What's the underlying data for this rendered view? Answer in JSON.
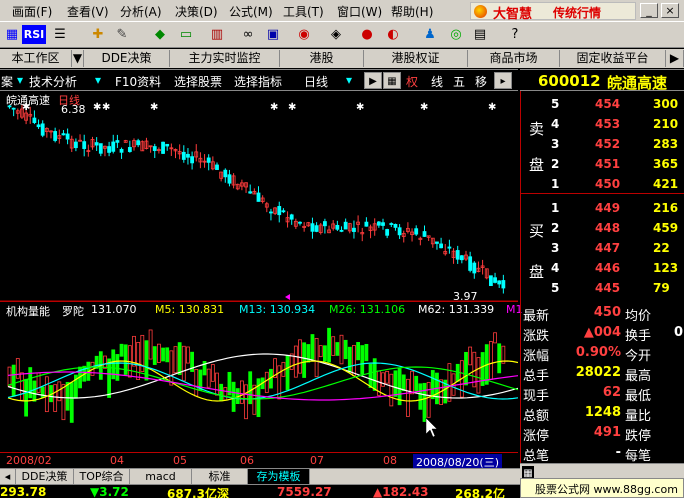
{
  "menu": [
    "画面(F)",
    "查看(V)",
    "分析(A)",
    "决策(D)",
    "公式(M)",
    "工具(T)",
    "窗口(W)",
    "帮助(H)"
  ],
  "brand": {
    "title": "大智慧",
    "subtitle": "传统行情"
  },
  "toolbar": {
    "rsi_label": "RSI"
  },
  "tabs": [
    "本工作区",
    "DDE决策",
    "主力实时监控",
    "港股",
    "港股权证",
    "商品市场",
    "固定收益平台"
  ],
  "subbar": {
    "first": "案",
    "tech": "技术分析",
    "f10": "F10资料",
    "select": "选择股票",
    "indicator": "选择指标",
    "period": "日线",
    "quan": "权",
    "xian": "线",
    "wu": "五",
    "yi": "移"
  },
  "stock": {
    "code": "600012",
    "name": "皖通高速"
  },
  "chart": {
    "title": "皖通高速",
    "period_tag": "日线",
    "high_label": "6.38",
    "low_label": "3.97"
  },
  "vol_line": {
    "name": "机构量能",
    "prefix": "罗陀",
    "v1": "131.070",
    "m5": "M5: 130.831",
    "m13": "M13: 130.934",
    "m26": "M26: 131.106",
    "m62": "M62: 131.339",
    "tail": "M1"
  },
  "xaxis": {
    "labels": [
      "2008/02",
      "04",
      "05",
      "06",
      "07",
      "08"
    ],
    "date": "2008/08/20(三)"
  },
  "orderbook": {
    "sell_label": [
      "卖",
      "盘"
    ],
    "buy_label": [
      "买",
      "盘"
    ],
    "sell": [
      [
        "5",
        "454",
        "300"
      ],
      [
        "4",
        "453",
        "210"
      ],
      [
        "3",
        "452",
        "283"
      ],
      [
        "2",
        "451",
        "365"
      ],
      [
        "1",
        "450",
        "421"
      ]
    ],
    "buy": [
      [
        "1",
        "449",
        "216"
      ],
      [
        "2",
        "448",
        "459"
      ],
      [
        "3",
        "447",
        "22"
      ],
      [
        "4",
        "446",
        "123"
      ],
      [
        "5",
        "445",
        "79"
      ]
    ]
  },
  "stats": [
    {
      "l1": "最新",
      "v1": "450",
      "l2": "均价",
      "v2": ""
    },
    {
      "l1": "涨跌",
      "v1": "▲004",
      "l2": "换手",
      "v2": "0"
    },
    {
      "l1": "涨幅",
      "v1": "0.90%",
      "l2": "今开",
      "v2": ""
    },
    {
      "l1": "总手",
      "v1": "28022",
      "l2": "最高",
      "v2": ""
    },
    {
      "l1": "现手",
      "v1": "62",
      "l2": "最低",
      "v2": ""
    },
    {
      "l1": "总额",
      "v1": "1248",
      "l2": "量比",
      "v2": ""
    },
    {
      "l1": "涨停",
      "v1": "491",
      "l2": "跌停",
      "v2": ""
    },
    {
      "l1": "总笔",
      "v1": "-",
      "l2": "每笔",
      "v2": ""
    }
  ],
  "btabs": [
    "DDE决策",
    "TOP综合",
    "macd",
    "标准",
    "存为模板"
  ],
  "ticker": [
    {
      "t": "293.78",
      "c": "#ffff00"
    },
    {
      "t": "▼3.72",
      "c": "#00ff00"
    },
    {
      "t": "687.3亿深",
      "c": "#ffff00"
    },
    {
      "t": "7559.27",
      "c": "#ff4040"
    },
    {
      "t": "▲182.43",
      "c": "#ff4040"
    },
    {
      "t": "268.2亿",
      "c": "#ffff00"
    }
  ],
  "site": "股票公式网 www.88gg.com",
  "colors": {
    "up": "#ff3c3c",
    "down": "#00ffff",
    "vol_green": "#00ff00",
    "bg": "#000000",
    "menu_bg": "#d4d0c8"
  }
}
